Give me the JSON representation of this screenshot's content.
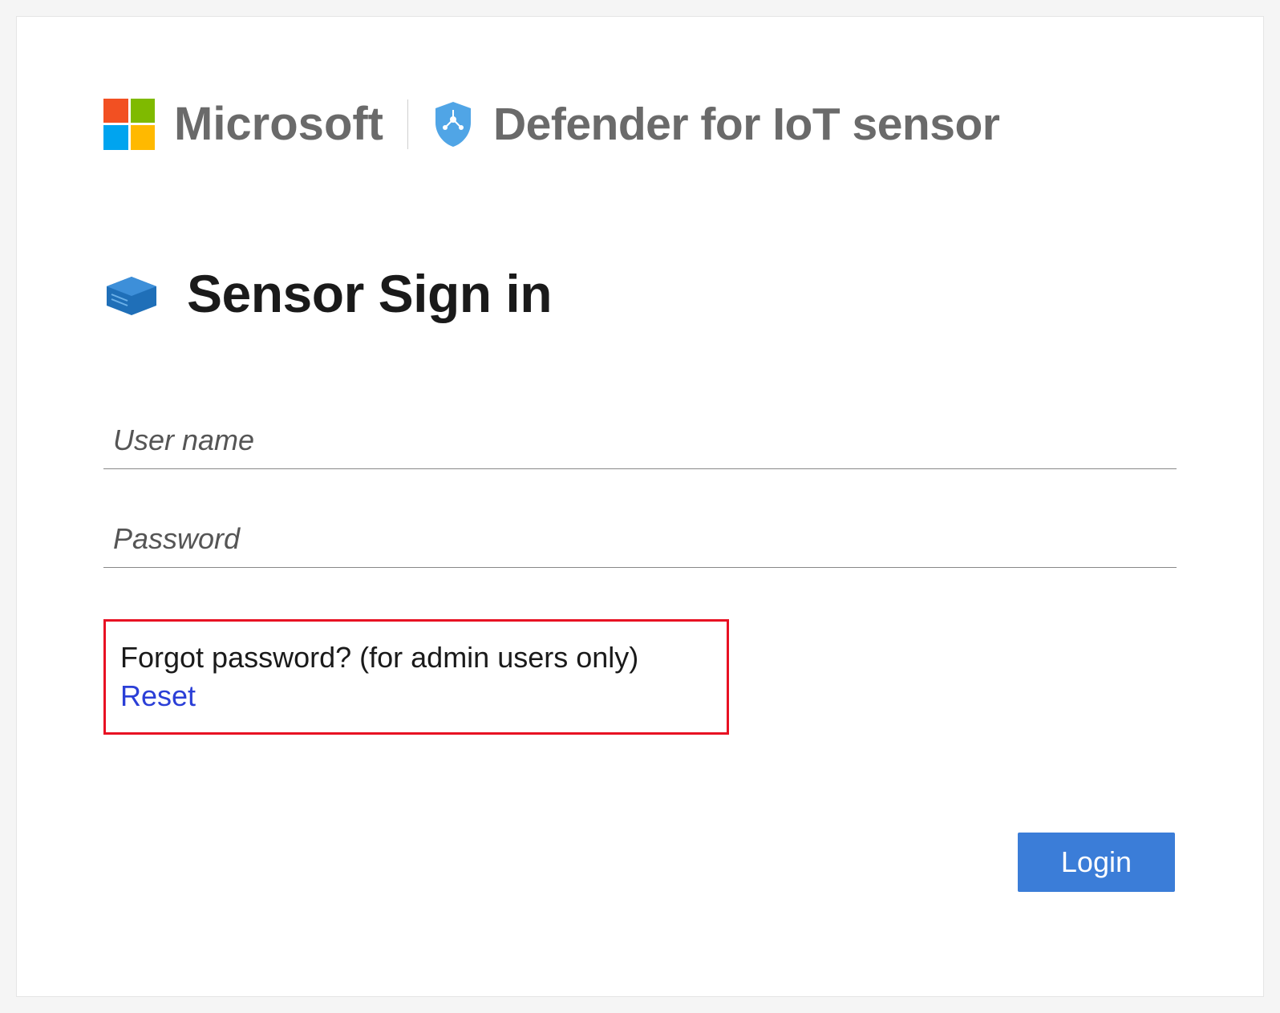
{
  "header": {
    "brand": "Microsoft",
    "product": "Defender for IoT sensor"
  },
  "page": {
    "title": "Sensor Sign in"
  },
  "form": {
    "username_placeholder": "User name",
    "password_placeholder": "Password",
    "forgot_text": "Forgot password? (for admin users only)",
    "reset_link": "Reset",
    "login_label": "Login"
  }
}
